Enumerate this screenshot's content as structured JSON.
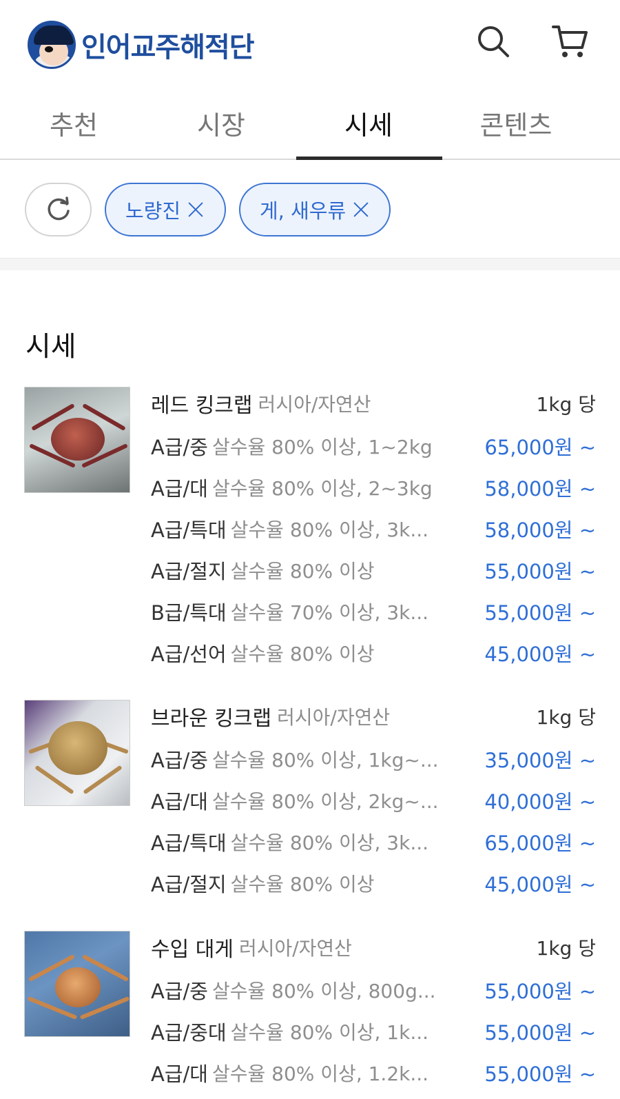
{
  "header": {
    "brand": "인어교주해적단",
    "search_icon": "search-icon",
    "cart_icon": "cart-icon"
  },
  "tabs": [
    {
      "label": "추천",
      "active": false
    },
    {
      "label": "시장",
      "active": false
    },
    {
      "label": "시세",
      "active": true
    },
    {
      "label": "콘텐츠",
      "active": false
    }
  ],
  "filters": {
    "refresh_icon": "refresh-icon",
    "chips": [
      {
        "label": "노량진"
      },
      {
        "label": "게, 새우류"
      }
    ]
  },
  "section": {
    "title": "시세"
  },
  "products": [
    {
      "name": "레드 킹크랩",
      "origin": "러시아/자연산",
      "unit": "1kg 당",
      "rows": [
        {
          "grade": "A급/중",
          "desc": "살수율 80% 이상, 1~2kg",
          "price": "65,000원 ~"
        },
        {
          "grade": "A급/대",
          "desc": "살수율 80% 이상, 2~3kg",
          "price": "58,000원 ~"
        },
        {
          "grade": "A급/특대",
          "desc": "살수율 80% 이상, 3k...",
          "price": "58,000원 ~"
        },
        {
          "grade": "A급/절지",
          "desc": "살수율 80% 이상",
          "price": "55,000원 ~"
        },
        {
          "grade": "B급/특대",
          "desc": "살수율 70% 이상, 3k...",
          "price": "55,000원 ~"
        },
        {
          "grade": "A급/선어",
          "desc": "살수율 80% 이상",
          "price": "45,000원 ~"
        }
      ]
    },
    {
      "name": "브라운 킹크랩",
      "origin": "러시아/자연산",
      "unit": "1kg 당",
      "rows": [
        {
          "grade": "A급/중",
          "desc": "살수율 80% 이상, 1kg~...",
          "price": "35,000원 ~"
        },
        {
          "grade": "A급/대",
          "desc": "살수율 80% 이상, 2kg~...",
          "price": "40,000원 ~"
        },
        {
          "grade": "A급/특대",
          "desc": "살수율 80% 이상, 3k...",
          "price": "65,000원 ~"
        },
        {
          "grade": "A급/절지",
          "desc": "살수율 80% 이상",
          "price": "45,000원 ~"
        }
      ]
    },
    {
      "name": "수입 대게",
      "origin": "러시아/자연산",
      "unit": "1kg 당",
      "rows": [
        {
          "grade": "A급/중",
          "desc": "살수율 80% 이상, 800g...",
          "price": "55,000원 ~"
        },
        {
          "grade": "A급/중대",
          "desc": "살수율 80% 이상, 1k...",
          "price": "55,000원 ~"
        },
        {
          "grade": "A급/대",
          "desc": "살수율 80% 이상, 1.2k...",
          "price": "55,000원 ~"
        }
      ]
    }
  ],
  "colors": {
    "brand": "#1f4e9e",
    "price": "#2f6fd6",
    "chip_border": "#3d75d4",
    "chip_bg": "#edf3fd"
  }
}
